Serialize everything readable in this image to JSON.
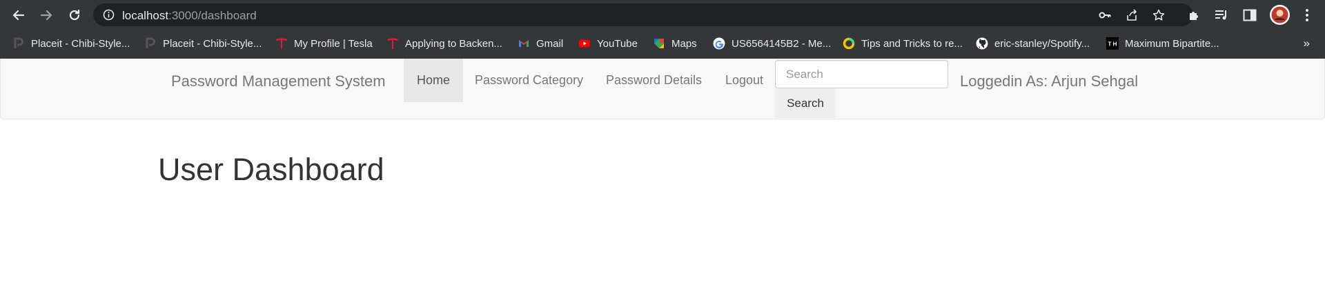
{
  "browser": {
    "url_host": "localhost",
    "url_rest": ":3000/dashboard",
    "bookmarks": [
      {
        "label": "Placeit - Chibi-Style...",
        "icon": "placeit-icon"
      },
      {
        "label": "Placeit - Chibi-Style...",
        "icon": "placeit-icon"
      },
      {
        "label": "My Profile | Tesla",
        "icon": "tesla-icon"
      },
      {
        "label": "Applying to Backen...",
        "icon": "tesla-icon"
      },
      {
        "label": "Gmail",
        "icon": "gmail-icon"
      },
      {
        "label": "YouTube",
        "icon": "youtube-icon"
      },
      {
        "label": "Maps",
        "icon": "maps-icon"
      },
      {
        "label": "US6564145B2 - Me...",
        "icon": "google-icon"
      },
      {
        "label": "Tips and Tricks to re...",
        "icon": "ring-icon"
      },
      {
        "label": "eric-stanley/Spotify...",
        "icon": "github-icon"
      },
      {
        "label": "Maximum Bipartite...",
        "icon": "th-icon"
      }
    ],
    "more_label": "»"
  },
  "navbar": {
    "brand": "Password Management System",
    "links": [
      "Home",
      "Password Category",
      "Password Details",
      "Logout"
    ],
    "search_placeholder": "Search",
    "search_button": "Search",
    "logged_in": "Loggedin As: Arjun Sehgal"
  },
  "main": {
    "title": "User Dashboard"
  }
}
